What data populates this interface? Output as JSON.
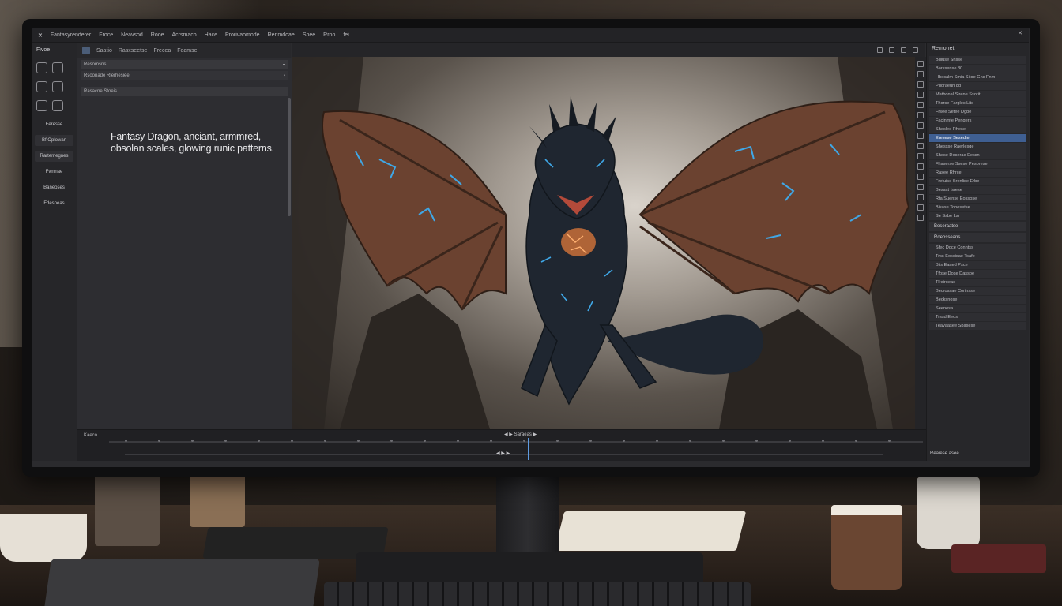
{
  "app": {
    "menu_items": [
      "Fantasyrenderer",
      "Froce",
      "Neavsod",
      "Rooe",
      "Acrsmaco",
      "Hace",
      "Prorivaomode",
      "Renmdoae",
      "Shee",
      "Rroo",
      "fei"
    ],
    "close_icon": "close-icon"
  },
  "tabs": [
    "Saatio",
    "Rasxseetse",
    "Frecea",
    "Feamse"
  ],
  "left_rail": {
    "items": [
      {
        "label": "Fivoe"
      },
      {
        "label": "Feresse"
      },
      {
        "label": "Bf Oplowan"
      },
      {
        "label": "Rartemegnes"
      },
      {
        "label": "Fvmnae"
      },
      {
        "label": "Baneoses"
      },
      {
        "label": "Fdesneas"
      }
    ]
  },
  "prompt_panel": {
    "header": "Resomsns",
    "subheader": "Rsoonade Rlerhesiee",
    "section_label": "Rasacne Stoeis",
    "prompt": "Fantasy Dragon, anciant, armmred, obsolan scales, glowing runic patterns."
  },
  "canvas": {
    "subject": "Fantasy Dragon, anciant, armmred, obsolan scales, glowing runic patterns.",
    "wing_color": "#6b4230",
    "scale_color": "#1f2630",
    "rune_color": "#3fa7e6",
    "glow_color": "#e07a3a"
  },
  "layers_panel": {
    "title": "Remonet",
    "rows": [
      {
        "label": "Buluse Snsse"
      },
      {
        "label": "Barssense 80"
      },
      {
        "label": "Hbecalm Smia Sitoe Gns Fnm"
      },
      {
        "label": "Puoraeun 8d"
      },
      {
        "label": "Mathonal Sirene Ssorit"
      },
      {
        "label": "Thorse Farglec Lits"
      },
      {
        "label": "Frsee Setee Dgbe"
      },
      {
        "label": "Facinmte Pengers"
      },
      {
        "label": "Sheslee Rhese"
      },
      {
        "label": "Eresese Sesedter",
        "selected": true
      },
      {
        "label": "Shessse Raerlesge"
      },
      {
        "label": "Shese Deserae Eessn"
      },
      {
        "label": "Fhaserse Ssese Pesorese"
      },
      {
        "label": "Rasee Rhrce"
      },
      {
        "label": "Frefuise Srenlise Erbe"
      },
      {
        "label": "Bessat fsrese"
      },
      {
        "label": "Rfa Suense Eossose"
      },
      {
        "label": "Bisase Tonesetse"
      },
      {
        "label": "Se Ssbe Lsr"
      }
    ],
    "section2_title": "Beseraatse",
    "section2_label": "Roeosseans",
    "rows2": [
      {
        "label": "Sfec Doce Conntss"
      },
      {
        "label": "Trss Eoscisae Tsafe"
      },
      {
        "label": "Bils Eaaed Psce"
      },
      {
        "label": "Tfose Dose Dassoe"
      },
      {
        "label": "Tlreiroeae"
      },
      {
        "label": "Becrossae Corinsse"
      },
      {
        "label": "Becksnose"
      },
      {
        "label": "Seenesa"
      },
      {
        "label": "Trssd Eeos"
      },
      {
        "label": "Teavaasee Sbasese"
      }
    ],
    "footer": "Reaiese asee"
  },
  "timeline": {
    "label": "Kaeco",
    "controls": "◀ ▶ Saraeas ▶",
    "controls_bottom": "◀ ▶ ▶"
  }
}
